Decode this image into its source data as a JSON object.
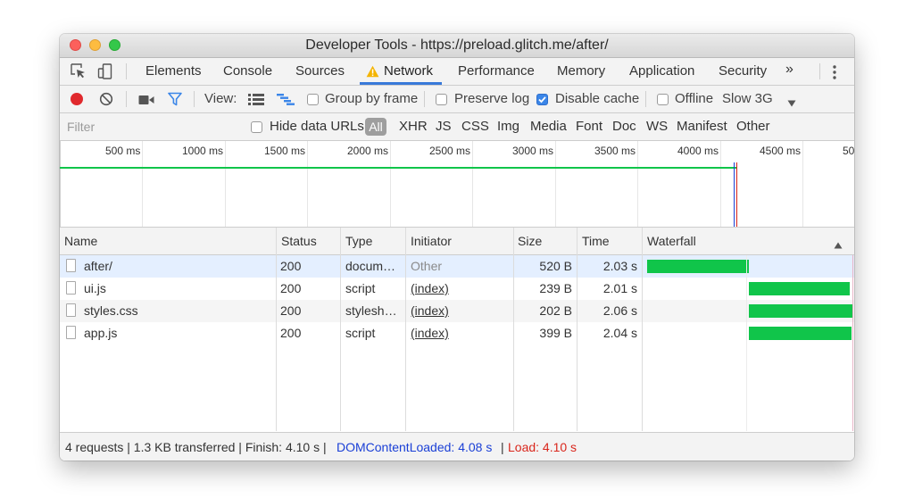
{
  "window": {
    "title": "Developer Tools - https://preload.glitch.me/after/"
  },
  "tabs": [
    "Elements",
    "Console",
    "Sources",
    "Network",
    "Performance",
    "Memory",
    "Application",
    "Security"
  ],
  "active_tab": "Network",
  "more_tabs_glyph": "»",
  "toolbar": {
    "view_label": "View:",
    "group_by_frame": {
      "label": "Group by frame",
      "checked": false
    },
    "preserve_log": {
      "label": "Preserve log",
      "checked": false
    },
    "disable_cache": {
      "label": "Disable cache",
      "checked": true
    },
    "offline": {
      "label": "Offline",
      "checked": false
    },
    "throttling": "Slow 3G"
  },
  "filter": {
    "placeholder": "Filter",
    "hide_data_urls": {
      "label": "Hide data URLs",
      "checked": false
    },
    "types": [
      "All",
      "XHR",
      "JS",
      "CSS",
      "Img",
      "Media",
      "Font",
      "Doc",
      "WS",
      "Manifest",
      "Other"
    ]
  },
  "overview": {
    "tick_labels": [
      "500 ms",
      "1000 ms",
      "1500 ms",
      "2000 ms",
      "2500 ms",
      "3000 ms",
      "3500 ms",
      "4000 ms",
      "4500 ms",
      "50"
    ]
  },
  "columns": [
    "Name",
    "Status",
    "Type",
    "Initiator",
    "Size",
    "Time",
    "Waterfall"
  ],
  "requests": [
    {
      "name": "after/",
      "status": "200",
      "type": "docum…",
      "initiator": "Other",
      "size": "520 B",
      "time": "2.03 s",
      "start_s": 0.0,
      "duration_s": 2.03
    },
    {
      "name": "ui.js",
      "status": "200",
      "type": "script",
      "initiator": "(index)",
      "size": "239 B",
      "time": "2.01 s",
      "start_s": 2.03,
      "duration_s": 2.01
    },
    {
      "name": "styles.css",
      "status": "200",
      "type": "stylesh…",
      "initiator": "(index)",
      "size": "202 B",
      "time": "2.06 s",
      "start_s": 2.03,
      "duration_s": 2.06
    },
    {
      "name": "app.js",
      "status": "200",
      "type": "script",
      "initiator": "(index)",
      "size": "399 B",
      "time": "2.04 s",
      "start_s": 2.03,
      "duration_s": 2.04
    }
  ],
  "status_bar": {
    "summary": "4 requests | 1.3 KB transferred | Finish: 4.10 s |",
    "dom_content_loaded": "DOMContentLoaded: 4.08 s",
    "separator": "|",
    "load": "Load: 4.10 s"
  },
  "colors": {
    "accent": "#3879d9",
    "record": "#e0292d",
    "filter_icon": "#3b86e8",
    "waterfall_bar": "#10c54a",
    "dom_content_loaded": "#1a3fd6",
    "load": "#d9261c"
  }
}
